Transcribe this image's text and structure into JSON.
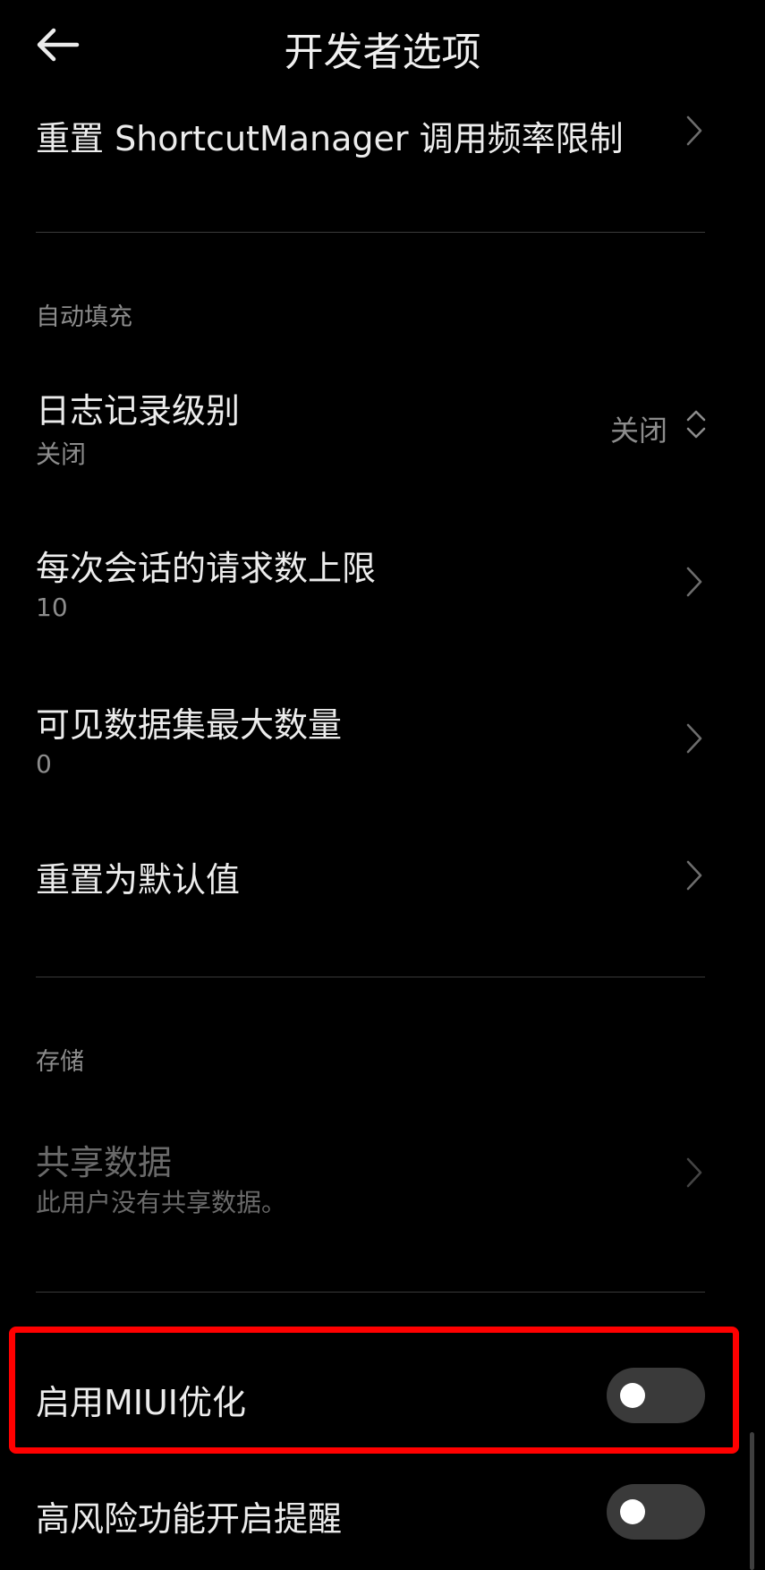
{
  "header": {
    "title": "开发者选项",
    "back_icon": "arrow-left-icon"
  },
  "rows": {
    "reset_shortcut": {
      "title": "重置 ShortcutManager 调用频率限制"
    },
    "autofill_section": "自动填充",
    "log_level": {
      "title": "日志记录级别",
      "subtitle": "关闭",
      "value": "关闭"
    },
    "max_requests": {
      "title": "每次会话的请求数上限",
      "subtitle": "10"
    },
    "max_datasets": {
      "title": "可见数据集最大数量",
      "subtitle": "0"
    },
    "reset_default": {
      "title": "重置为默认值"
    },
    "storage_section": "存储",
    "shared_data": {
      "title": "共享数据",
      "subtitle": "此用户没有共享数据。",
      "disabled": true
    },
    "miui_opt": {
      "title": "启用MIUI优化",
      "toggle": false
    },
    "high_risk": {
      "title": "高风险功能开启提醒",
      "toggle": false
    }
  },
  "colors": {
    "background": "#000000",
    "highlight": "#ff0000",
    "toggle_off": "#3a3a3a"
  }
}
